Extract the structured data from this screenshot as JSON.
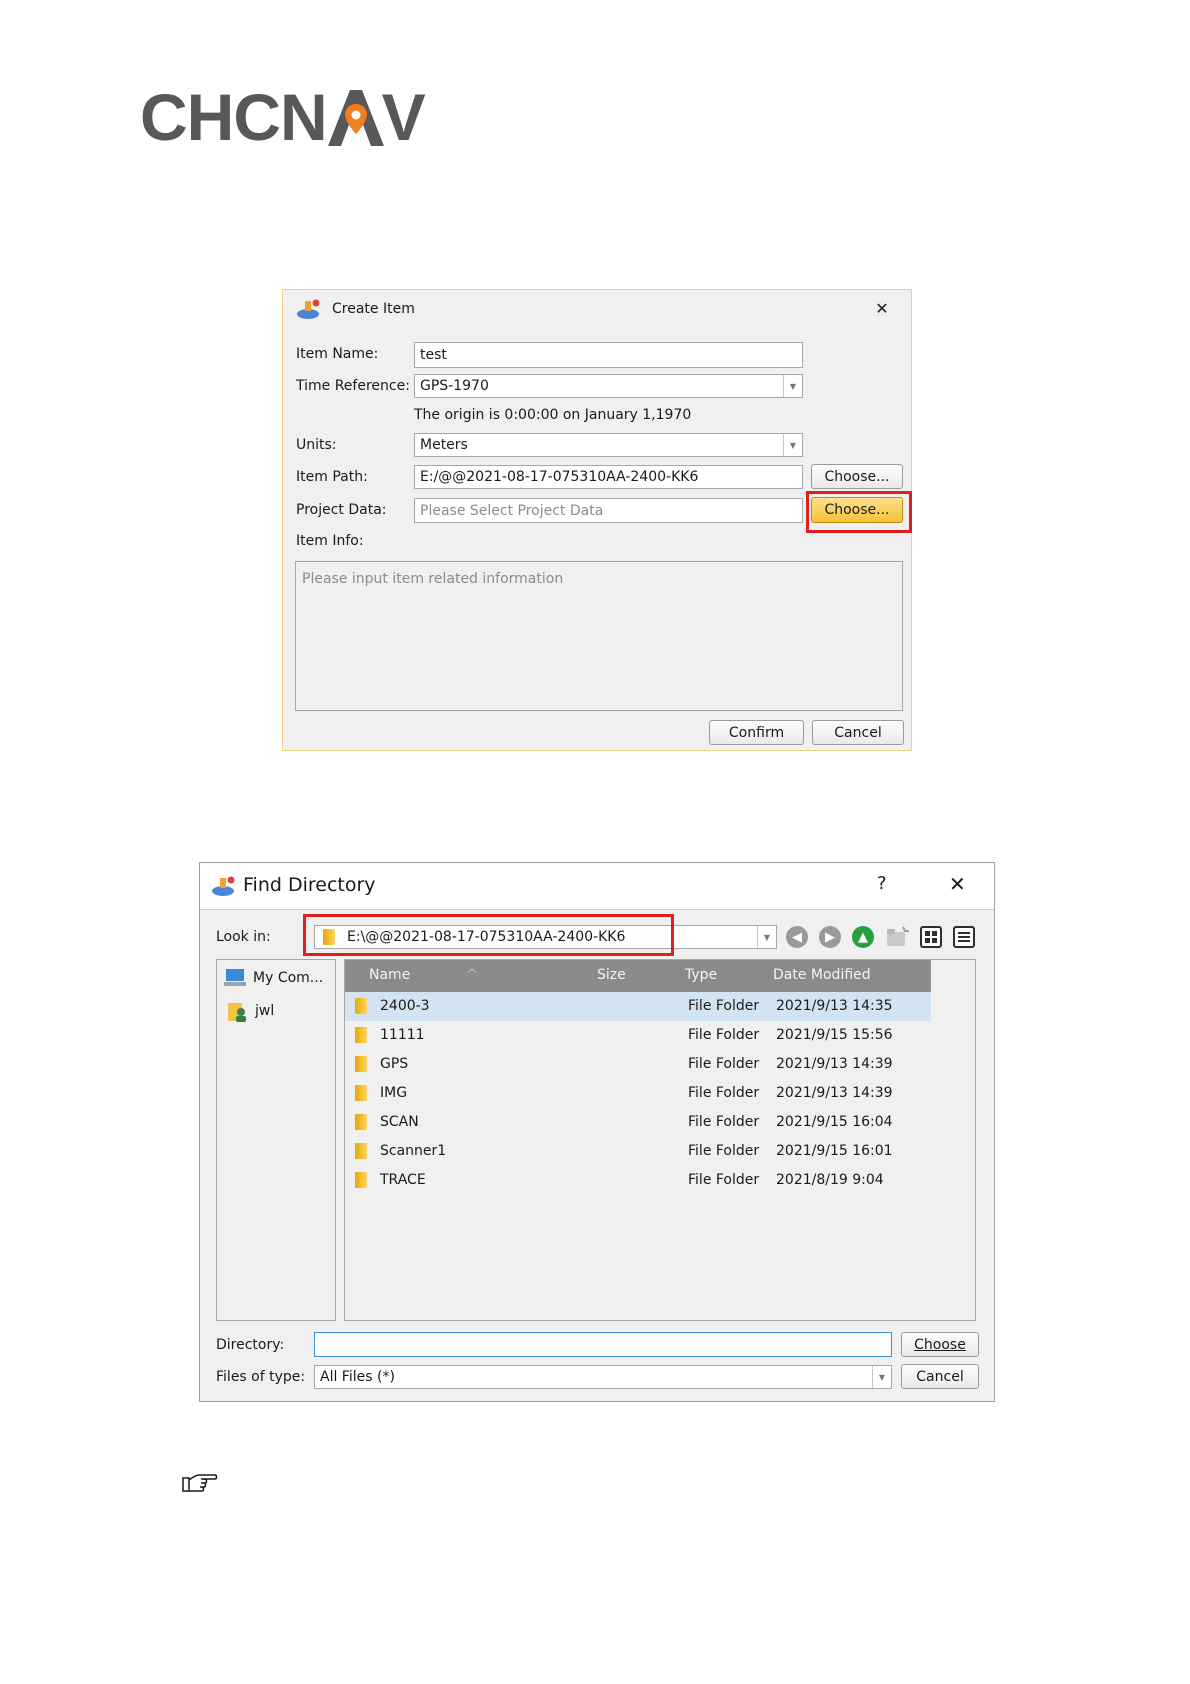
{
  "logo": {
    "text_left": "CHCN",
    "text_right": "V",
    "accent_color": "#f07f22",
    "text_color": "#58585a"
  },
  "create_item": {
    "title": "Create Item",
    "close_icon": "close-icon",
    "item_name": {
      "label": "Item Name:",
      "value": "test"
    },
    "time_reference": {
      "label": "Time Reference:",
      "value": "GPS-1970",
      "note": "The origin is 0:00:00 on January 1,1970"
    },
    "units": {
      "label": "Units:",
      "value": "Meters"
    },
    "item_path": {
      "label": "Item Path:",
      "value": "E:/@@2021-08-17-075310AA-2400-KK6",
      "button": "Choose..."
    },
    "project_data": {
      "label": "Project Data:",
      "placeholder": "Please Select Project Data",
      "button": "Choose..."
    },
    "item_info": {
      "label": "Item Info:",
      "placeholder": "Please input item related information"
    },
    "confirm": "Confirm",
    "cancel": "Cancel"
  },
  "find_directory": {
    "title": "Find Directory",
    "help": "?",
    "close": "✕",
    "look_in": {
      "label": "Look in:",
      "value": "E:\\@@2021-08-17-075310AA-2400-KK6"
    },
    "sidebar": [
      {
        "label": "My Com..."
      },
      {
        "label": "jwl"
      }
    ],
    "columns": {
      "name": "Name",
      "size": "Size",
      "type": "Type",
      "date": "Date Modified"
    },
    "rows": [
      {
        "name": "2400-3",
        "type": "File Folder",
        "date": "2021/9/13 14:35"
      },
      {
        "name": "11111",
        "type": "File Folder",
        "date": "2021/9/15 15:56"
      },
      {
        "name": "GPS",
        "type": "File Folder",
        "date": "2021/9/13 14:39"
      },
      {
        "name": "IMG",
        "type": "File Folder",
        "date": "2021/9/13 14:39"
      },
      {
        "name": "SCAN",
        "type": "File Folder",
        "date": "2021/9/15 16:04"
      },
      {
        "name": "Scanner1",
        "type": "File Folder",
        "date": "2021/9/15 16:01"
      },
      {
        "name": "TRACE",
        "type": "File Folder",
        "date": "2021/8/19 9:04"
      }
    ],
    "directory": {
      "label": "Directory:",
      "value": ""
    },
    "files_of_type": {
      "label": "Files of type:",
      "value": "All Files (*)"
    },
    "choose": "Choose",
    "cancel": "Cancel"
  },
  "note_icon": "pointing-hand-icon"
}
